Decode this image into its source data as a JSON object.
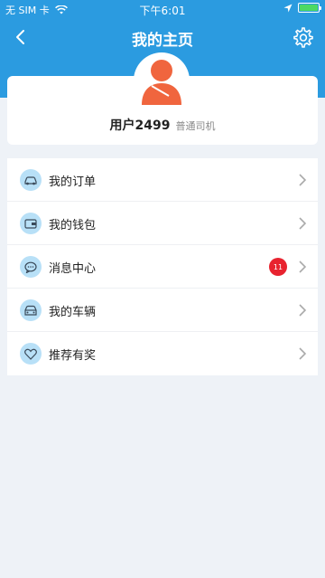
{
  "status_bar": {
    "carrier": "无 SIM 卡",
    "time": "下午6:01",
    "battery_level": 1.0
  },
  "nav": {
    "title": "我的主页",
    "back_icon": "chevron-left-icon",
    "settings_icon": "gear-icon"
  },
  "profile": {
    "username": "用户2499",
    "user_type": "普通司机",
    "avatar_icon": "person-icon",
    "avatar_color": "#f0653e"
  },
  "menu": {
    "items": [
      {
        "label": "我的订单",
        "icon": "car-icon"
      },
      {
        "label": "我的钱包",
        "icon": "wallet-icon"
      },
      {
        "label": "消息中心",
        "icon": "chat-icon",
        "badge": "11"
      },
      {
        "label": "我的车辆",
        "icon": "vehicle-icon"
      },
      {
        "label": "推荐有奖",
        "icon": "heart-icon"
      }
    ]
  },
  "colors": {
    "header_bg": "#2b9be0",
    "badge": "#e8232f",
    "icon_bg": "#b8e0f7"
  }
}
